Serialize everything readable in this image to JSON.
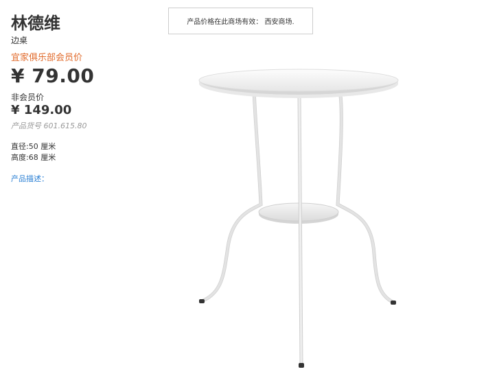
{
  "product": {
    "name": "林德维",
    "type": "边桌",
    "member_price_label": "宜家俱乐部会员价",
    "member_price": "¥ 79.00",
    "nonmember_price_label": "非会员价",
    "nonmember_price": "¥ 149.00",
    "article_number": "产品货号 601.615.80",
    "specs": {
      "diameter": "直径:50 厘米",
      "height": "高度:68 厘米"
    },
    "description_link": "产品描述："
  },
  "store_notice": "产品价格在此商场有效：  西安商场.",
  "colors": {
    "accent_orange": "#e16a2a",
    "link_blue": "#2a7fd4",
    "muted_gray": "#999999",
    "text": "#333333"
  },
  "icons": {
    "product_image": "white-side-table-image"
  }
}
